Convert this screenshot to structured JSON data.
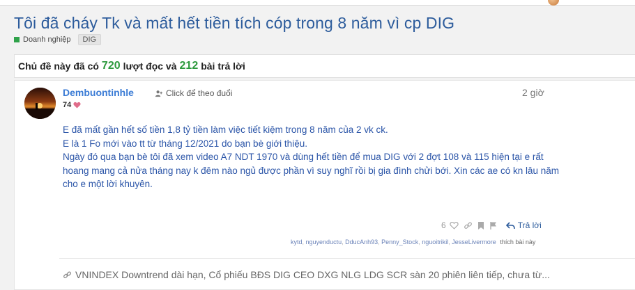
{
  "thread": {
    "title": "Tôi đã cháy Tk và mất hết tiền tích cóp trong 8 năm vì cp DIG",
    "category": "Doanh nghiệp",
    "tag": "DIG",
    "category_color": "#2fa24a"
  },
  "stats": {
    "prefix": "Chủ đề này đã có",
    "views": "720",
    "views_label": "lượt đọc và",
    "replies": "212",
    "replies_label": "bài trả lời",
    "number_color": "#2e9a3e"
  },
  "post": {
    "author": "Dembuontinhle",
    "follow_label": "Click để theo đuổi",
    "time": "2 giờ",
    "reputation": "74",
    "paragraphs": [
      "E đã mất gần hết số tiền 1,8 tỷ tiền làm việc tiết kiệm trong 8 năm của 2 vk ck.",
      "E là 1 Fo mới vào tt từ tháng 12/2021 do bạn bè giới thiệu.",
      "Ngày đó qua bạn bè tôi đã xem video A7 NDT 1970 và dùng hết tiền để mua DIG với 2 đợt 108 và 115 hiện tại e rất hoang mang cả nửa tháng nay k đêm nào ngủ được phần vì suy nghĩ rồi bị gia đình chửi bới. Xin các ae có kn lâu năm cho e một lời khuyên."
    ],
    "like_count": "6",
    "reply_label": "Trả lời",
    "likers": [
      "kytd",
      "nguyenductu",
      "DducAnh93",
      "Penny_Stock",
      "nguoitrikil",
      "JesseLivermore"
    ],
    "likers_suffix": "thích bài này",
    "signature": "VNINDEX Downtrend dài hạn, Cổ phiếu BĐS DIG CEO DXG NLG LDG SCR sàn 20 phiên liên tiếp, chưa từ..."
  },
  "icons": {
    "follow": "person-add-icon",
    "heart": "heart-icon",
    "like": "heart-outline-icon",
    "link": "link-icon",
    "bookmark": "bookmark-icon",
    "report": "flag-icon",
    "reply": "reply-arrow-icon",
    "signature": "link-icon"
  },
  "colors": {
    "title": "#2d5c9c",
    "author": "#3a7bd5",
    "body_text": "#2b55a8",
    "heart": "#e06c8a"
  }
}
